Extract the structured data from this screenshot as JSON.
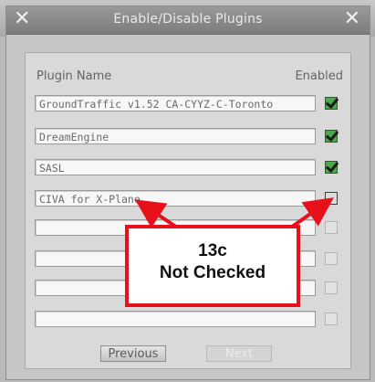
{
  "window": {
    "title": "Enable/Disable Plugins",
    "close_glyph": "✕"
  },
  "table": {
    "col_name": "Plugin Name",
    "col_enabled": "Enabled",
    "rows": [
      {
        "name": "GroundTraffic v1.52 CA-CYYZ-C-Toronto",
        "enabled": true,
        "state": "checked"
      },
      {
        "name": "DreamEngine",
        "enabled": true,
        "state": "checked"
      },
      {
        "name": "SASL",
        "enabled": true,
        "state": "checked"
      },
      {
        "name": "CIVA for X-Plane",
        "enabled": false,
        "state": "unchecked"
      },
      {
        "name": "",
        "enabled": false,
        "state": "disabled"
      },
      {
        "name": "",
        "enabled": false,
        "state": "disabled"
      },
      {
        "name": "",
        "enabled": false,
        "state": "disabled"
      },
      {
        "name": "",
        "enabled": false,
        "state": "disabled"
      }
    ]
  },
  "buttons": {
    "previous": "Previous",
    "next": "Next"
  },
  "annotation": {
    "line1": "13c",
    "line2": "Not Checked",
    "color": "#e8101a"
  }
}
